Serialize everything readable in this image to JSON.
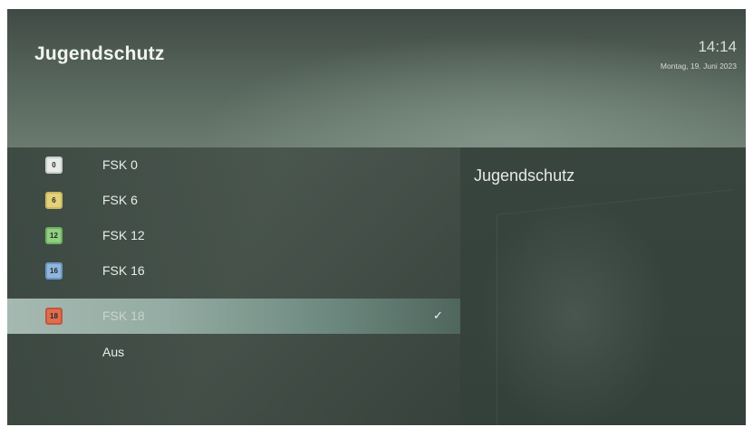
{
  "header": {
    "title": "Jugendschutz",
    "time": "14:14",
    "date": "Montag, 19. Juni 2023"
  },
  "menu": {
    "items": [
      {
        "label": "FSK 0",
        "badge": "0",
        "badge_color": "#e8ebe8",
        "selected": false
      },
      {
        "label": "FSK 6",
        "badge": "6",
        "badge_color": "#e3d27a",
        "selected": false
      },
      {
        "label": "FSK 12",
        "badge": "12",
        "badge_color": "#8fcf7f",
        "selected": false
      },
      {
        "label": "FSK 16",
        "badge": "16",
        "badge_color": "#8fb7de",
        "selected": false
      },
      {
        "label": "FSK 18",
        "badge": "18",
        "badge_color": "#e06d50",
        "selected": true,
        "checked": true
      },
      {
        "label": "Aus",
        "selected": false
      }
    ],
    "check_icon": "✓"
  },
  "detail": {
    "title": "Jugendschutz"
  }
}
